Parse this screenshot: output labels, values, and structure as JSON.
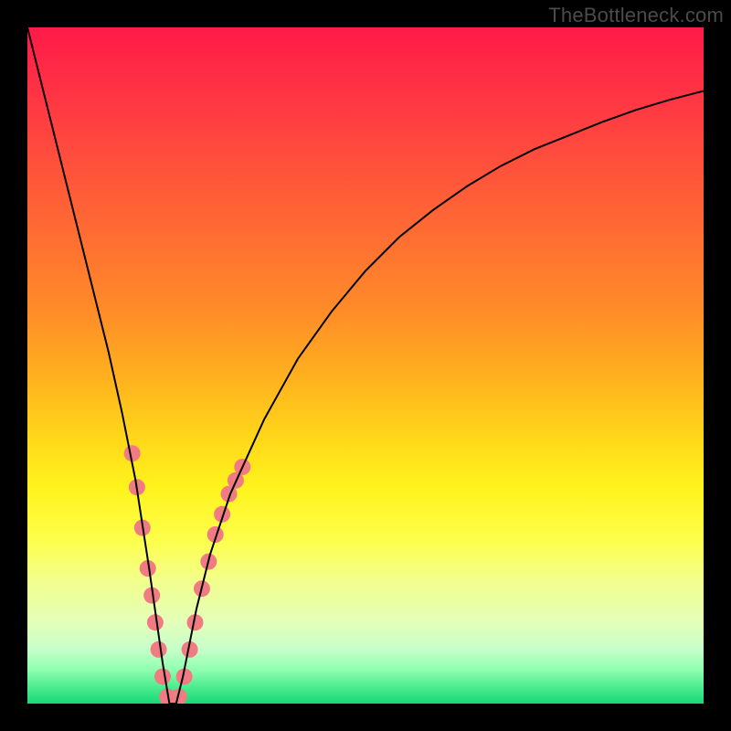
{
  "watermark": "TheBottleneck.com",
  "chart_data": {
    "type": "line",
    "title": "",
    "xlabel": "",
    "ylabel": "",
    "xlim": [
      0,
      100
    ],
    "ylim": [
      0,
      100
    ],
    "background_gradient": {
      "top_color": "#ff1a48",
      "mid_color": "#fff31c",
      "bottom_color": "#18d878"
    },
    "series": [
      {
        "name": "bottleneck-curve",
        "x": [
          0,
          2,
          4,
          6,
          8,
          10,
          12,
          14,
          16,
          18,
          19,
          20,
          21,
          22,
          23,
          24,
          25,
          27,
          30,
          35,
          40,
          45,
          50,
          55,
          60,
          65,
          70,
          75,
          80,
          85,
          90,
          95,
          100
        ],
        "y": [
          100,
          92,
          84,
          76,
          68,
          60,
          52,
          43,
          33,
          20,
          13,
          6,
          0,
          0,
          4,
          9,
          14,
          22,
          31,
          42,
          51,
          58,
          64,
          69,
          73,
          76.5,
          79.5,
          82,
          84,
          86,
          87.8,
          89.3,
          90.6
        ],
        "stroke": "#000000",
        "stroke_width": 2
      }
    ],
    "markers": {
      "name": "highlight-dots",
      "color": "#f07b82",
      "radius": 9,
      "points": [
        {
          "x": 15.5,
          "y": 37
        },
        {
          "x": 16.2,
          "y": 32
        },
        {
          "x": 17.0,
          "y": 26
        },
        {
          "x": 17.8,
          "y": 20
        },
        {
          "x": 18.4,
          "y": 16
        },
        {
          "x": 18.9,
          "y": 12
        },
        {
          "x": 19.4,
          "y": 8
        },
        {
          "x": 20.0,
          "y": 4
        },
        {
          "x": 20.7,
          "y": 1
        },
        {
          "x": 21.5,
          "y": 0
        },
        {
          "x": 22.4,
          "y": 1
        },
        {
          "x": 23.2,
          "y": 4
        },
        {
          "x": 24.0,
          "y": 8
        },
        {
          "x": 24.8,
          "y": 12
        },
        {
          "x": 25.8,
          "y": 17
        },
        {
          "x": 26.8,
          "y": 21
        },
        {
          "x": 27.8,
          "y": 25
        },
        {
          "x": 28.8,
          "y": 28
        },
        {
          "x": 29.8,
          "y": 31
        },
        {
          "x": 30.8,
          "y": 33
        },
        {
          "x": 31.8,
          "y": 35
        }
      ]
    }
  }
}
